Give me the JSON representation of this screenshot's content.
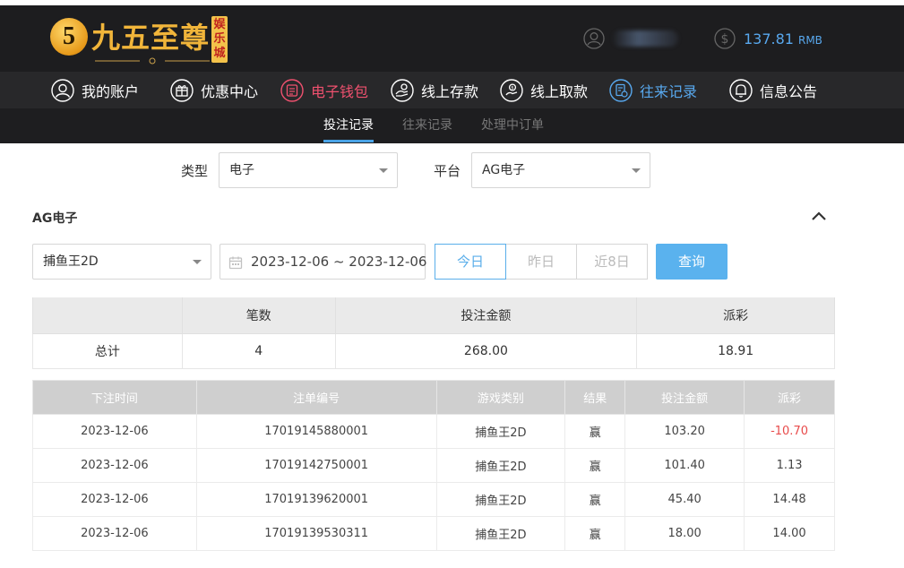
{
  "brand": {
    "logo_char": "5",
    "name": "九五至尊",
    "tag": "娱乐城",
    "accent": "#f1b53a"
  },
  "account": {
    "user_icon": "user-circle-icon",
    "balance": "137.81",
    "currency": "RMB",
    "balance_icon": "dollar-circle-icon",
    "balance_color": "#58a8ee"
  },
  "nav": {
    "items": [
      {
        "label": "我的账户",
        "icon": "user-icon"
      },
      {
        "label": "优惠中心",
        "icon": "gift-icon"
      },
      {
        "label": "电子钱包",
        "icon": "wallet-icon"
      },
      {
        "label": "线上存款",
        "icon": "deposit-icon"
      },
      {
        "label": "线上取款",
        "icon": "withdraw-icon"
      },
      {
        "label": "往来记录",
        "icon": "record-icon"
      },
      {
        "label": "信息公告",
        "icon": "bell-icon"
      }
    ]
  },
  "subtabs": [
    "投注记录",
    "往来记录",
    "处理中订单"
  ],
  "filters": {
    "type_label": "类型",
    "type_value": "电子",
    "platform_label": "平台",
    "platform_value": "AG电子"
  },
  "section": {
    "title": "AG电子"
  },
  "query": {
    "game_value": "捕鱼王2D",
    "date_range": "2023-12-06 ~ 2023-12-06",
    "quick_buttons": [
      "今日",
      "昨日",
      "近8日"
    ],
    "submit": "查询"
  },
  "summary": {
    "headers": [
      "",
      "笔数",
      "投注金额",
      "派彩"
    ],
    "row": [
      "总计",
      "4",
      "268.00",
      "18.91"
    ]
  },
  "detail": {
    "headers": [
      "下注时间",
      "注单编号",
      "游戏类别",
      "结果",
      "投注金额",
      "派彩"
    ],
    "rows": [
      [
        "2023-12-06",
        "17019145880001",
        "捕鱼王2D",
        "赢",
        "103.20",
        "-10.70"
      ],
      [
        "2023-12-06",
        "17019142750001",
        "捕鱼王2D",
        "赢",
        "101.40",
        "1.13"
      ],
      [
        "2023-12-06",
        "17019139620001",
        "捕鱼王2D",
        "赢",
        "45.40",
        "14.48"
      ],
      [
        "2023-12-06",
        "17019139530311",
        "捕鱼王2D",
        "赢",
        "18.00",
        "14.00"
      ]
    ]
  }
}
